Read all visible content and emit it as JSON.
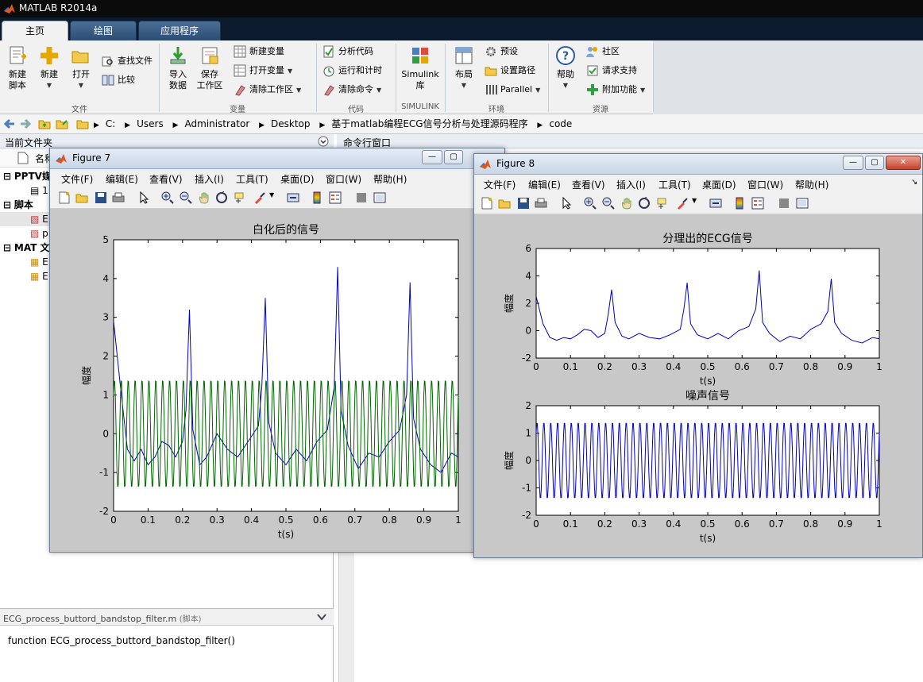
{
  "app": {
    "title": "MATLAB R2014a",
    "tabs": [
      {
        "label": "主页"
      },
      {
        "label": "绘图"
      },
      {
        "label": "应用程序"
      }
    ]
  },
  "ribbon": {
    "file": {
      "label": "文件",
      "new_script": "新建\n脚本",
      "new": "新建",
      "open": "打开",
      "find_files": "查找文件",
      "compare": "比较"
    },
    "variable": {
      "label": "变量",
      "import": "导入\n数据",
      "save_ws": "保存\n工作区",
      "new_var": "新建变量",
      "open_var": "打开变量",
      "clear_ws": "清除工作区"
    },
    "code": {
      "label": "代码",
      "analyze": "分析代码",
      "run_time": "运行和计时",
      "clear_cmd": "清除命令"
    },
    "simulink": {
      "label": "SIMULINK",
      "lib": "Simulink\n库"
    },
    "env": {
      "label": "环境",
      "layout": "布局",
      "prefs": "预设",
      "set_path": "设置路径",
      "parallel": "Parallel"
    },
    "resources": {
      "label": "资源",
      "help": "帮助",
      "community": "社区",
      "support": "请求支持",
      "addons": "附加功能"
    }
  },
  "address": {
    "crumbs": [
      "C:",
      "Users",
      "Administrator",
      "Desktop",
      "基于matlab编程ECG信号分析与处理源码程序",
      "code"
    ]
  },
  "current_folder": {
    "title": "当前文件夹",
    "name_col": "名称",
    "items": [
      {
        "label": "PPTV媒",
        "indent": 0,
        "kind": "folder-head"
      },
      {
        "label": "1",
        "indent": 1,
        "kind": "file"
      },
      {
        "label": "脚本",
        "indent": 0,
        "kind": "folder-head"
      },
      {
        "label": "E",
        "indent": 1,
        "kind": "script",
        "selected": true
      },
      {
        "label": "p",
        "indent": 1,
        "kind": "script"
      },
      {
        "label": "MAT 文",
        "indent": 0,
        "kind": "folder-head"
      },
      {
        "label": "E",
        "indent": 1,
        "kind": "mat"
      },
      {
        "label": "E",
        "indent": 1,
        "kind": "mat"
      }
    ],
    "detail_file": "ECG_process_buttord_bandstop_filter.m",
    "detail_tag": "(脚本)",
    "detail_code": "function ECG_process_buttord_bandstop_filter()"
  },
  "command_window": {
    "title": "命令行窗口"
  },
  "figure_menu": [
    "文件(F)",
    "编辑(E)",
    "查看(V)",
    "插入(I)",
    "工具(T)",
    "桌面(D)",
    "窗口(W)",
    "帮助(H)"
  ],
  "figure7": {
    "title": "Figure 7",
    "chart_data": {
      "type": "line",
      "title": "白化后的信号",
      "xlabel": "t(s)",
      "ylabel": "幅度",
      "xlim": [
        0,
        1
      ],
      "ylim": [
        -2,
        5
      ],
      "xticks": [
        "0",
        "0.1",
        "0.2",
        "0.3",
        "0.4",
        "0.5",
        "0.6",
        "0.7",
        "0.8",
        "0.9",
        "1"
      ],
      "yticks": [
        "-2",
        "-1",
        "0",
        "1",
        "2",
        "3",
        "4",
        "5"
      ],
      "series": [
        {
          "color": "#0000cc",
          "x": [
            0,
            0.02,
            0.04,
            0.06,
            0.08,
            0.1,
            0.12,
            0.14,
            0.16,
            0.18,
            0.2,
            0.21,
            0.22,
            0.23,
            0.25,
            0.27,
            0.3,
            0.33,
            0.36,
            0.39,
            0.42,
            0.43,
            0.44,
            0.45,
            0.47,
            0.5,
            0.53,
            0.56,
            0.59,
            0.62,
            0.64,
            0.65,
            0.66,
            0.68,
            0.71,
            0.74,
            0.77,
            0.8,
            0.83,
            0.85,
            0.86,
            0.87,
            0.89,
            0.92,
            0.95,
            0.98,
            1.0
          ],
          "y": [
            2.9,
            1.2,
            -0.4,
            -0.7,
            -0.4,
            -0.8,
            -0.6,
            -0.2,
            -0.3,
            -0.6,
            -0.2,
            0.6,
            3.2,
            0.1,
            -0.8,
            -0.6,
            0.0,
            -0.4,
            -0.6,
            -0.2,
            0.2,
            1.2,
            3.5,
            0.3,
            -0.5,
            -0.8,
            -0.4,
            -0.7,
            -0.2,
            0.1,
            1.2,
            4.3,
            0.6,
            -0.3,
            -0.9,
            -0.5,
            -0.6,
            -0.2,
            0.1,
            1.0,
            3.9,
            0.4,
            -0.4,
            -0.8,
            -1.0,
            -0.5,
            -0.6
          ]
        },
        {
          "color": "#006600",
          "kind": "sine",
          "amplitude": 1.4,
          "cycles": 50
        }
      ]
    }
  },
  "figure8": {
    "title": "Figure 8",
    "chart_data": [
      {
        "type": "line",
        "title": "分理出的ECG信号",
        "xlabel": "t(s)",
        "ylabel": "幅度",
        "xlim": [
          0,
          1
        ],
        "ylim": [
          -2,
          6
        ],
        "xticks": [
          "0",
          "0.1",
          "0.2",
          "0.3",
          "0.4",
          "0.5",
          "0.6",
          "0.7",
          "0.8",
          "0.9",
          "1"
        ],
        "yticks": [
          "-2",
          "0",
          "2",
          "4",
          "6"
        ],
        "series": [
          {
            "color": "#0000cc",
            "x": [
              0,
              0.02,
              0.04,
              0.06,
              0.08,
              0.1,
              0.12,
              0.14,
              0.16,
              0.18,
              0.2,
              0.21,
              0.22,
              0.23,
              0.25,
              0.27,
              0.3,
              0.33,
              0.36,
              0.39,
              0.42,
              0.43,
              0.44,
              0.45,
              0.47,
              0.5,
              0.53,
              0.56,
              0.59,
              0.62,
              0.64,
              0.65,
              0.66,
              0.68,
              0.71,
              0.74,
              0.77,
              0.8,
              0.83,
              0.85,
              0.86,
              0.87,
              0.89,
              0.92,
              0.95,
              0.98,
              1.0
            ],
            "y": [
              2.5,
              0.5,
              -0.5,
              -0.7,
              -0.5,
              -0.6,
              -0.3,
              0.1,
              0.0,
              -0.5,
              -0.2,
              1.2,
              3.0,
              0.6,
              -0.4,
              -0.6,
              -0.2,
              -0.5,
              -0.6,
              -0.3,
              0.1,
              1.5,
              3.5,
              0.5,
              -0.3,
              -0.6,
              -0.2,
              -0.6,
              0.0,
              0.3,
              1.6,
              4.4,
              0.6,
              -0.2,
              -0.8,
              -0.4,
              -0.6,
              0.1,
              0.5,
              1.4,
              3.8,
              0.6,
              -0.2,
              -0.7,
              -0.9,
              -0.5,
              -0.6
            ]
          }
        ]
      },
      {
        "type": "line",
        "title": "噪声信号",
        "xlabel": "t(s)",
        "ylabel": "幅度",
        "xlim": [
          0,
          1
        ],
        "ylim": [
          -2,
          2
        ],
        "xticks": [
          "0",
          "0.1",
          "0.2",
          "0.3",
          "0.4",
          "0.5",
          "0.6",
          "0.7",
          "0.8",
          "0.9",
          "1"
        ],
        "yticks": [
          "-2",
          "-1",
          "0",
          "1",
          "2"
        ],
        "series": [
          {
            "color": "#0000cc",
            "kind": "sine",
            "amplitude": 1.4,
            "cycles": 50
          }
        ]
      }
    ]
  }
}
